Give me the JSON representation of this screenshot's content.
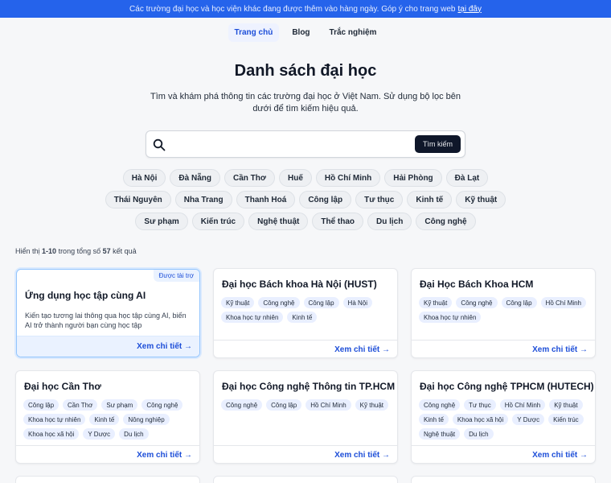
{
  "banner": {
    "text": "Các trường đại học và học viện khác đang được thêm vào hàng ngày. Góp ý cho trang web",
    "link": "tại đây"
  },
  "nav": [
    "Trang chủ",
    "Blog",
    "Trắc nghiệm"
  ],
  "page": {
    "title": "Danh sách đại học",
    "subtitle": "Tìm và khám phá thông tin các trường đại học ở Việt Nam. Sử dụng bộ lọc bên dưới để tìm kiếm hiệu quả."
  },
  "search": {
    "placeholder": "",
    "button": "Tìm kiếm"
  },
  "filters": [
    "Hà Nội",
    "Đà Nẵng",
    "Cần Thơ",
    "Huế",
    "Hồ Chí Minh",
    "Hải Phòng",
    "Đà Lạt",
    "Thái Nguyên",
    "Nha Trang",
    "Thanh Hoá",
    "Công lập",
    "Tư thục",
    "Kinh tế",
    "Kỹ thuật",
    "Sư phạm",
    "Kiến trúc",
    "Nghệ thuật",
    "Thể thao",
    "Du lịch",
    "Công nghệ"
  ],
  "results": {
    "prefix": "Hiển thị",
    "range": "1-10",
    "middle": "trong tổng số",
    "total": "57",
    "suffix": "kết quả"
  },
  "sponsored": {
    "badge": "Được tài trợ",
    "title": "Ứng dụng học tập cùng AI",
    "desc": "Kiến tạo tương lai thông qua học tập cùng AI, biến AI trở thành người bạn cùng học tập",
    "more": "Xem chi tiết →"
  },
  "cards": [
    {
      "title": "Đại học Bách khoa Hà Nội (HUST)",
      "tags": [
        "Kỹ thuật",
        "Công nghệ",
        "Công lập",
        "Hà Nội",
        "Khoa học tự nhiên",
        "Kinh tế"
      ],
      "more": "Xem chi tiết →"
    },
    {
      "title": "Đại Học Bách Khoa HCM",
      "tags": [
        "Kỹ thuật",
        "Công nghệ",
        "Công lập",
        "Hồ Chí Minh",
        "Khoa học tự nhiên"
      ],
      "more": "Xem chi tiết →"
    },
    {
      "title": "Đại học Cần Thơ",
      "tags": [
        "Công lập",
        "Cần Thơ",
        "Sư phạm",
        "Công nghệ",
        "Khoa học tự nhiên",
        "Kinh tế",
        "Nông nghiệp",
        "Khoa học xã hội",
        "Y Dược",
        "Du lịch"
      ],
      "more": "Xem chi tiết →"
    },
    {
      "title": "Đại học Công nghệ Thông tin TP.HCM",
      "tags": [
        "Công nghệ",
        "Công lập",
        "Hồ Chí Minh",
        "Kỹ thuật"
      ],
      "more": "Xem chi tiết →"
    },
    {
      "title": "Đại học Công nghệ TPHCM (HUTECH)",
      "tags": [
        "Công nghệ",
        "Tư thục",
        "Hồ Chí Minh",
        "Kỹ thuật",
        "Kinh tế",
        "Khoa học xã hội",
        "Y Dược",
        "Kiến trúc",
        "Nghệ thuật",
        "Du lịch"
      ],
      "more": "Xem chi tiết →"
    }
  ]
}
